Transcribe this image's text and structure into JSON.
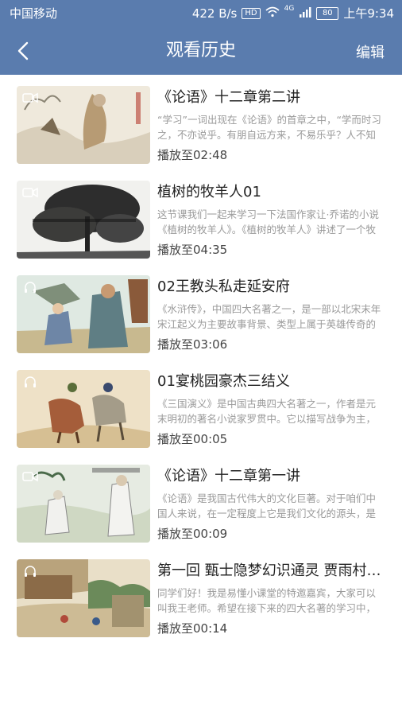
{
  "status_bar": {
    "carrier": "中国移动",
    "speed": "422 B/s",
    "hd": "HD",
    "net": "4G",
    "battery": "80",
    "time": "上午9:34"
  },
  "topbar": {
    "title": "观看历史",
    "edit_label": "编辑"
  },
  "items": [
    {
      "title": "《论语》十二章第二讲",
      "desc": "“学习”一词出现在《论语》的首章之中，“学而时习之，不亦说乎。有朋自远方来，不易乐乎？人不知而不愠，不亦君子乎？”",
      "progress": "播放至02:48",
      "type_icon": "video-icon"
    },
    {
      "title": "植树的牧羊人01",
      "desc": "这节课我们一起来学习一下法国作家让·乔诺的小说《植树的牧羊人》。《植树的牧羊人》讲述了一个牧羊人在荒原上种树的故事。",
      "progress": "播放至04:35",
      "type_icon": "video-icon"
    },
    {
      "title": "02王教头私走延安府",
      "desc": "《水浒传》，中国四大名著之一，是一部以北宋末年宋江起义为主要故事背景、类型上属于英雄传奇的章回体长篇小说。",
      "progress": "播放至03:06",
      "type_icon": "headphone-icon"
    },
    {
      "title": "01宴桃园豪杰三结义",
      "desc": "《三国演义》是中国古典四大名著之一，作者是元末明初的著名小说家罗贯中。它以描写战争为主，反映了魏、蜀、吴三个政治集团之间的斗争。",
      "progress": "播放至00:05",
      "type_icon": "headphone-icon"
    },
    {
      "title": "《论语》十二章第一讲",
      "desc": "《论语》是我国古代伟大的文化巨著。对于咱们中国人来说，在一定程度上它是我们文化的源头，是我们思想的根基。",
      "progress": "播放至00:09",
      "type_icon": "video-icon"
    },
    {
      "title": "第一回 甄士隐梦幻识通灵 贾雨村风尘怀闺秀",
      "desc": "同学们好！我是易懂小课堂的特邀嘉宾，大家可以叫我王老师。希望在接下来的四大名著的学习中，我能和大家一起学习。",
      "progress": "播放至00:14",
      "type_icon": "headphone-icon"
    }
  ],
  "colors": {
    "header_bg": "#5a7cae",
    "title_text": "#222222",
    "desc_text": "#9a9a9a"
  }
}
